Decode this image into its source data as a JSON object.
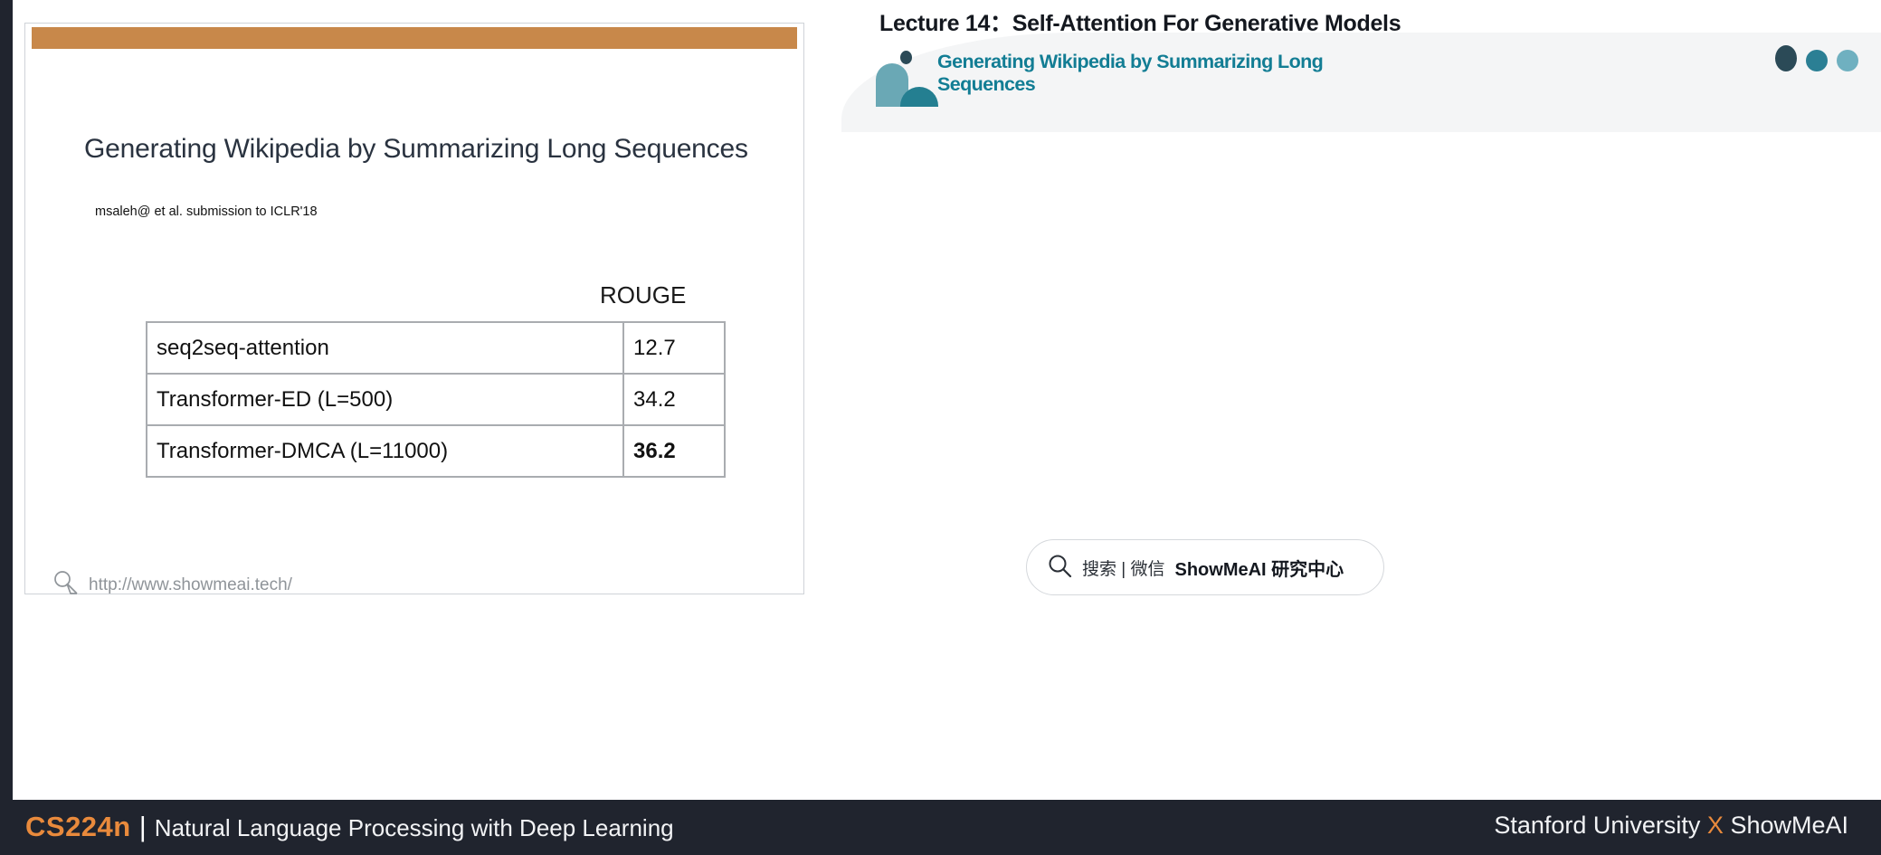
{
  "colors": {
    "accent_orange": "#e98a3c",
    "teal": "#127d94",
    "slide_topbar": "#c8884a",
    "footer_bg": "#20242e",
    "slide_title_color": "#2a3340"
  },
  "lecture": {
    "heading": "Lecture 14：Self-Attention For Generative Models"
  },
  "paper_header": {
    "title": "Generating Wikipedia by Summarizing Long Sequences",
    "logo_icon": "showmeai-logo-icon",
    "decor_dots": [
      "dark-dot",
      "teal-dot",
      "light-teal-dot"
    ]
  },
  "slide": {
    "title": "Generating Wikipedia by Summarizing Long Sequences",
    "subtitle": "msaleh@ et al. submission to ICLR'18",
    "watermark_url": "http://www.showmeai.tech/",
    "watermark_icon": "pen-cursor-icon"
  },
  "table": {
    "value_column_header": "ROUGE",
    "rows": [
      {
        "name": "seq2seq-attention",
        "value": "12.7",
        "bold": false
      },
      {
        "name": "Transformer-ED (L=500)",
        "value": "34.2",
        "bold": false
      },
      {
        "name": "Transformer-DMCA (L=11000)",
        "value": "36.2",
        "bold": true
      }
    ]
  },
  "search": {
    "icon": "magnifier-icon",
    "label": "搜索 | 微信",
    "brand": "ShowMeAI 研究中心"
  },
  "footer": {
    "course_code": "CS224n",
    "separator": "|",
    "course_name": "Natural Language Processing with Deep Learning",
    "right_prefix": "Stanford University ",
    "right_x": "X",
    "right_suffix": " ShowMeAI"
  }
}
